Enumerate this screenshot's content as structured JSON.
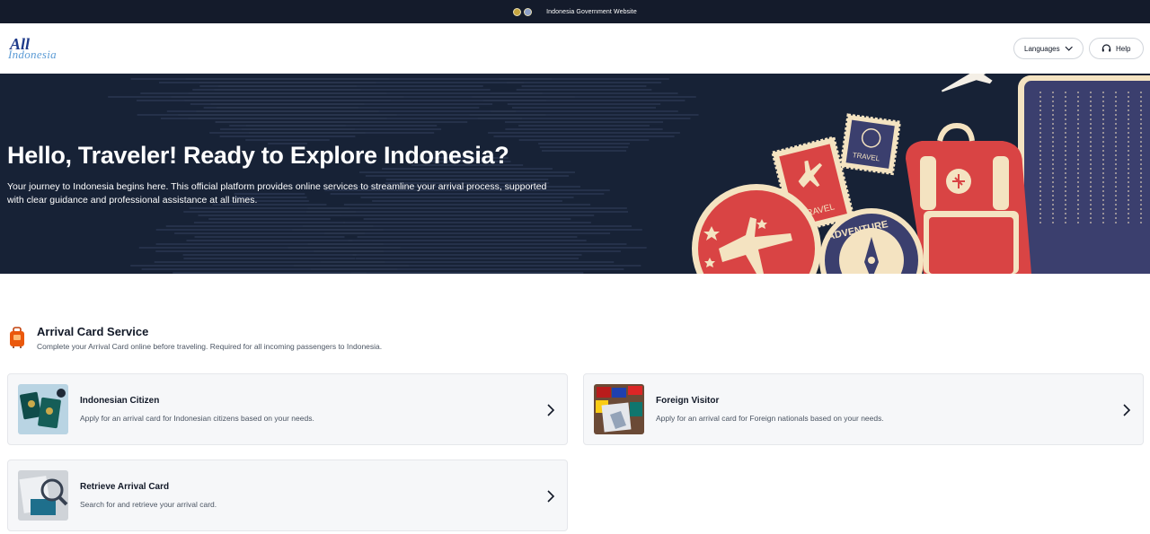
{
  "gov_bar": {
    "text": "Indonesia Government Website"
  },
  "header": {
    "logo": {
      "all": "All",
      "indonesia": "Indonesia"
    },
    "languages_label": "Languages",
    "help_label": "Help"
  },
  "hero": {
    "title": "Hello, Traveler! Ready to Explore Indonesia?",
    "subtitle": "Your journey to Indonesia begins here. This official platform provides online services to streamline your arrival process, supported with clear guidance and professional assistance at all times.",
    "stamp_travel_1": "TRAVEL",
    "stamp_travel_2": "TRAVEL",
    "badge_adventure": "ADVENTURE"
  },
  "section": {
    "title": "Arrival Card Service",
    "subtitle": "Complete your Arrival Card online before traveling. Required for all incoming passengers to Indonesia."
  },
  "cards": [
    {
      "title": "Indonesian Citizen",
      "description": "Apply for an arrival card for Indonesian citizens based on your needs."
    },
    {
      "title": "Foreign Visitor",
      "description": "Apply for an arrival card for Foreign nationals based on your needs."
    },
    {
      "title": "Retrieve Arrival Card",
      "description": "Search for and retrieve your arrival card."
    }
  ],
  "colors": {
    "gov_bar": "#141b2b",
    "hero_bg": "#172236",
    "accent_red": "#d94444",
    "accent_cream": "#f4e3c1",
    "accent_navy": "#3b3f6e"
  }
}
